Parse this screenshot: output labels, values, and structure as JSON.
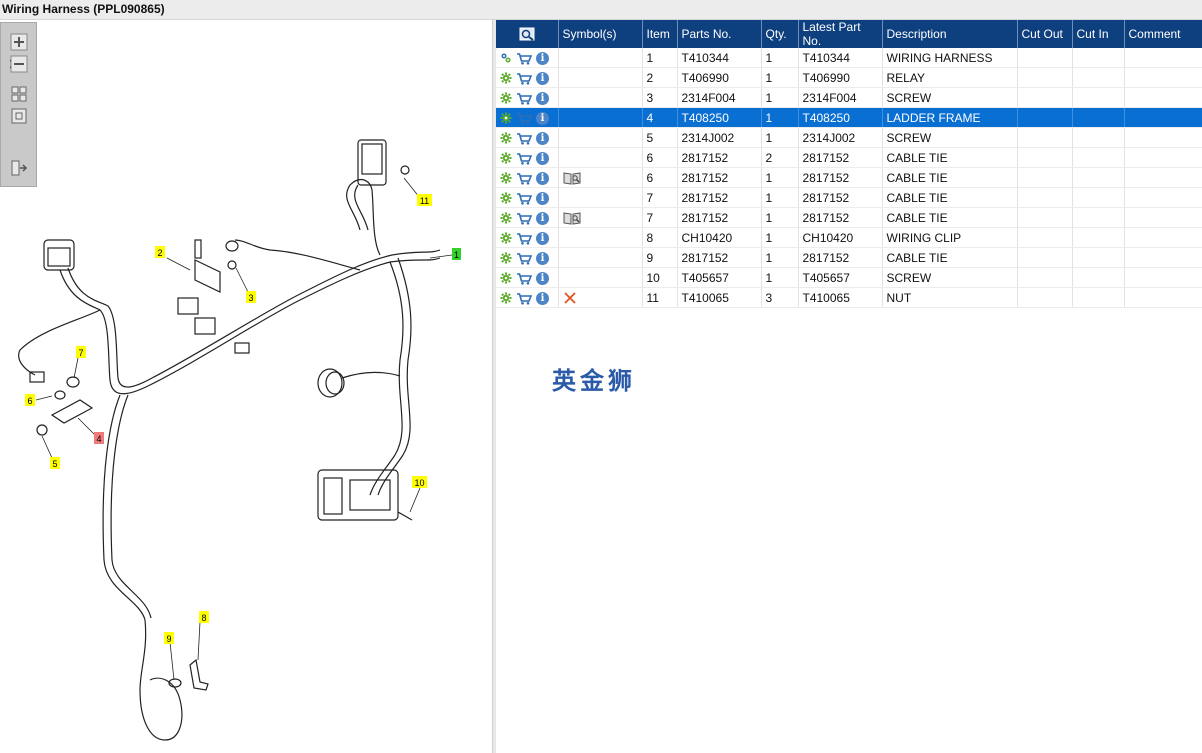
{
  "window": {
    "title": "Wiring Harness (PPL090865)"
  },
  "toolbox": {
    "buttons": [
      "zoom-in",
      "zoom-out",
      "fit-all",
      "fit-window",
      "export"
    ]
  },
  "table": {
    "columns": [
      "",
      "Symbol(s)",
      "Item",
      "Parts No.",
      "Qty.",
      "Latest Part No.",
      "Description",
      "Cut Out",
      "Cut In",
      "Comment"
    ],
    "rows": [
      {
        "item": "1",
        "part": "T410344",
        "qty": "1",
        "latest": "T410344",
        "desc": "WIRING HARNESS",
        "symbol": "",
        "first_icon": "assembly"
      },
      {
        "item": "2",
        "part": "T406990",
        "qty": "1",
        "latest": "T406990",
        "desc": "RELAY",
        "symbol": "",
        "first_icon": "gear"
      },
      {
        "item": "3",
        "part": "2314F004",
        "qty": "1",
        "latest": "2314F004",
        "desc": "SCREW",
        "symbol": "",
        "first_icon": "gear"
      },
      {
        "item": "4",
        "part": "T408250",
        "qty": "1",
        "latest": "T408250",
        "desc": "LADDER FRAME",
        "symbol": "",
        "first_icon": "gear",
        "selected": true
      },
      {
        "item": "5",
        "part": "2314J002",
        "qty": "1",
        "latest": "2314J002",
        "desc": "SCREW",
        "symbol": "",
        "first_icon": "gear"
      },
      {
        "item": "6",
        "part": "2817152",
        "qty": "2",
        "latest": "2817152",
        "desc": "CABLE TIE",
        "symbol": "",
        "first_icon": "gear"
      },
      {
        "item": "6",
        "part": "2817152",
        "qty": "1",
        "latest": "2817152",
        "desc": "CABLE TIE",
        "symbol": "book",
        "first_icon": "gear"
      },
      {
        "item": "7",
        "part": "2817152",
        "qty": "1",
        "latest": "2817152",
        "desc": "CABLE TIE",
        "symbol": "",
        "first_icon": "gear"
      },
      {
        "item": "7",
        "part": "2817152",
        "qty": "1",
        "latest": "2817152",
        "desc": "CABLE TIE",
        "symbol": "book",
        "first_icon": "gear"
      },
      {
        "item": "8",
        "part": "CH10420",
        "qty": "1",
        "latest": "CH10420",
        "desc": "WIRING CLIP",
        "symbol": "",
        "first_icon": "gear"
      },
      {
        "item": "9",
        "part": "2817152",
        "qty": "1",
        "latest": "2817152",
        "desc": "CABLE TIE",
        "symbol": "",
        "first_icon": "gear"
      },
      {
        "item": "10",
        "part": "T405657",
        "qty": "1",
        "latest": "T405657",
        "desc": "SCREW",
        "symbol": "",
        "first_icon": "gear"
      },
      {
        "item": "11",
        "part": "T410065",
        "qty": "3",
        "latest": "T410065",
        "desc": "NUT",
        "symbol": "cross",
        "first_icon": "gear"
      }
    ]
  },
  "watermark": {
    "text": "英金狮"
  },
  "diagram": {
    "callouts": [
      {
        "label": "1",
        "color": "#35d12b"
      },
      {
        "label": "2",
        "color": "#ffff00"
      },
      {
        "label": "3",
        "color": "#ffff00"
      },
      {
        "label": "4",
        "color": "#f07a7a"
      },
      {
        "label": "5",
        "color": "#ffff00"
      },
      {
        "label": "6",
        "color": "#ffff00"
      },
      {
        "label": "7",
        "color": "#ffff00"
      },
      {
        "label": "8",
        "color": "#ffff00"
      },
      {
        "label": "9",
        "color": "#ffff00"
      },
      {
        "label": "10",
        "color": "#ffff00"
      },
      {
        "label": "11",
        "color": "#ffff00"
      }
    ]
  },
  "colors": {
    "header_bg": "#0e3f7e",
    "selected_row": "#0a6fd3",
    "gear": "#5aab2a",
    "cart": "#2f6db5",
    "info": "#4c84c6",
    "cross": "#e0541f"
  }
}
